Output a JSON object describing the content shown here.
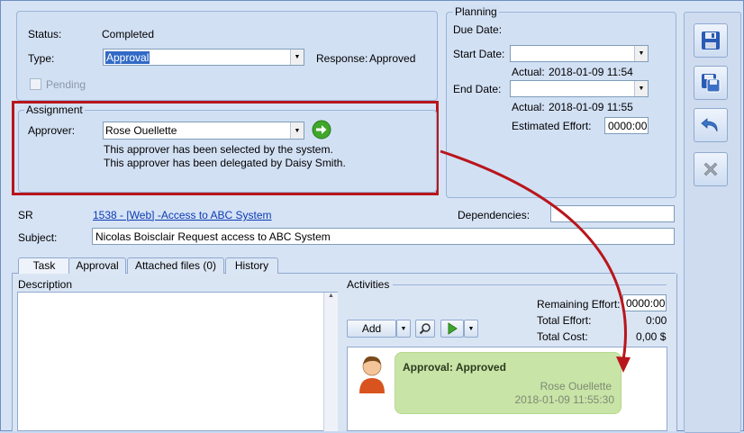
{
  "status": {
    "label": "Status:",
    "value": "Completed"
  },
  "type": {
    "label": "Type:",
    "value": "Approval"
  },
  "response": {
    "label": "Response:",
    "value": "Approved"
  },
  "pending": {
    "label": "Pending"
  },
  "planning": {
    "title": "Planning",
    "due_label": "Due Date:",
    "start_label": "Start Date:",
    "start_actual_label": "Actual:",
    "start_actual_value": "2018-01-09 11:54",
    "end_label": "End Date:",
    "end_actual_label": "Actual:",
    "end_actual_value": "2018-01-09 11:55",
    "effort_label": "Estimated Effort:",
    "effort_value": "0000:00"
  },
  "assignment": {
    "title": "Assignment",
    "approver_label": "Approver:",
    "approver_value": "Rose Ouellette",
    "note1": "This approver has been selected by the system.",
    "note2": "This approver has been delegated by Daisy Smith."
  },
  "sr": {
    "label": "SR",
    "link": "1538 - [Web] -Access to ABC System"
  },
  "dependencies": {
    "label": "Dependencies:"
  },
  "subject": {
    "label": "Subject:",
    "value": "Nicolas Boisclair Request access to ABC System"
  },
  "tabs": [
    "Task",
    "Approval",
    "Attached files (0)",
    "History"
  ],
  "description": {
    "label": "Description"
  },
  "activities": {
    "label": "Activities",
    "remaining_label": "Remaining Effort:",
    "remaining_value": "0000:00",
    "total_effort_label": "Total Effort:",
    "total_effort_value": "0:00",
    "total_cost_label": "Total Cost:",
    "total_cost_value": "0,00 $",
    "add_label": "Add"
  },
  "card": {
    "title": "Approval: Approved",
    "name": "Rose Ouellette",
    "time": "2018-01-09 11:55:30"
  },
  "colors": {
    "highlight_box": "#b8161c",
    "arrow": "#b8161c",
    "card_bg": "#c8e4a6",
    "selection": "#3169c6"
  }
}
